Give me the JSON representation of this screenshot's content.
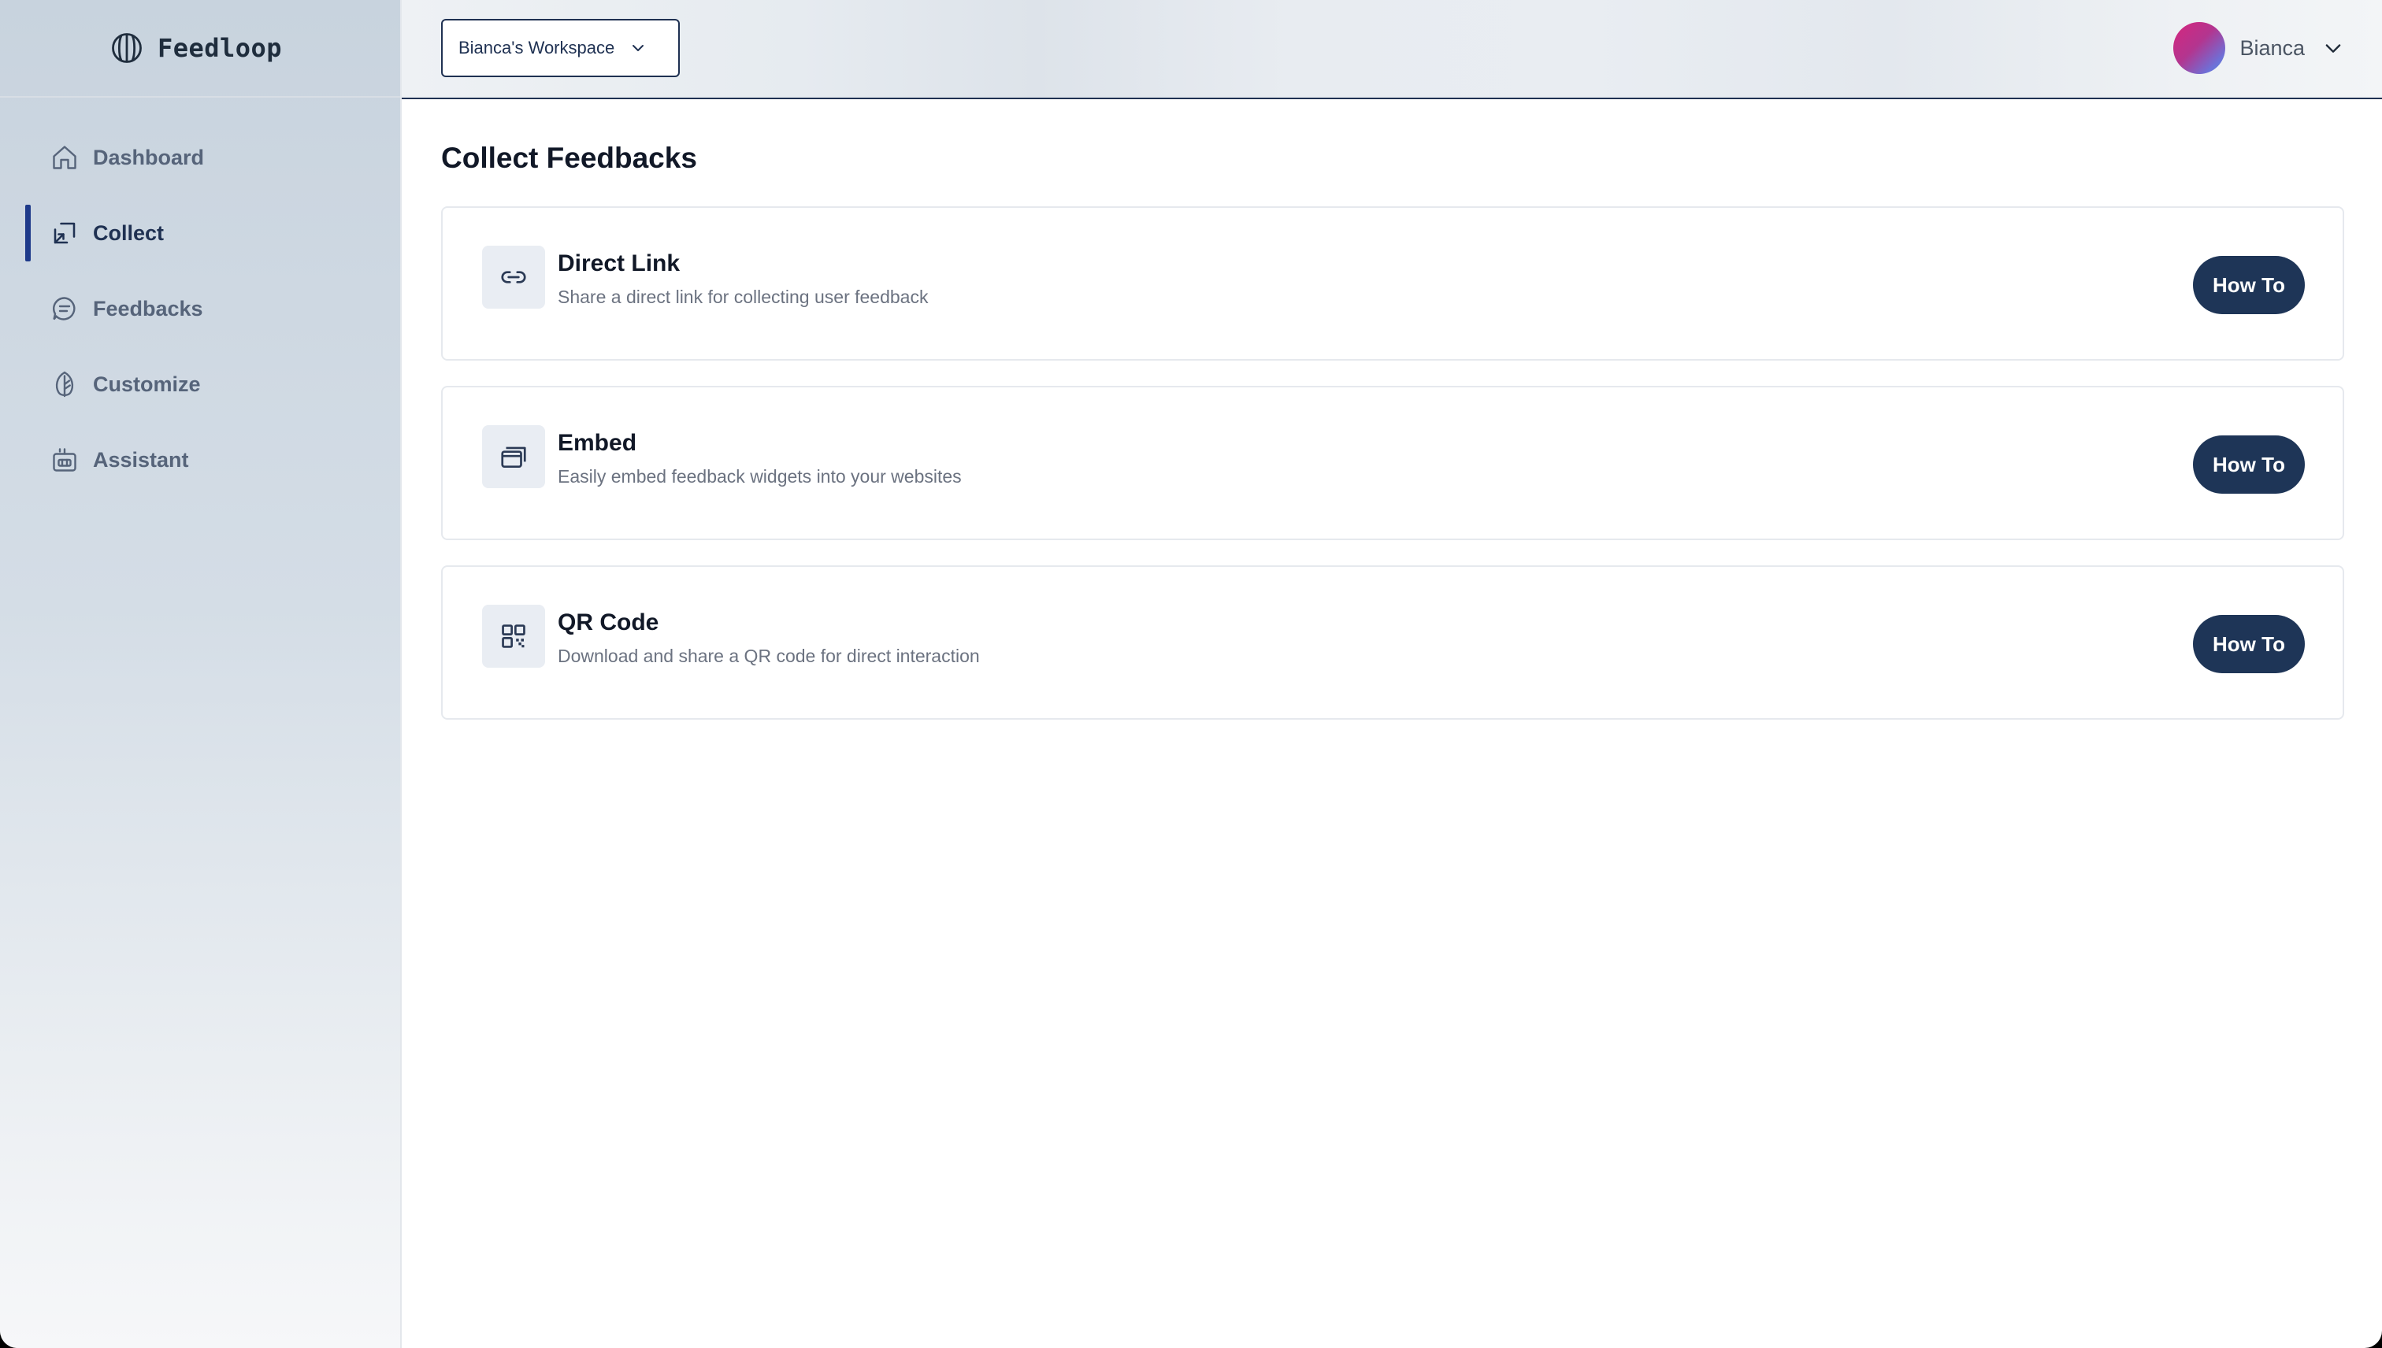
{
  "brand": {
    "name": "Feedloop",
    "icon": "logo-circle-icon"
  },
  "sidebar": {
    "items": [
      {
        "label": "Dashboard",
        "icon": "home-icon",
        "active": false
      },
      {
        "label": "Collect",
        "icon": "collect-cursor-icon",
        "active": true
      },
      {
        "label": "Feedbacks",
        "icon": "message-icon",
        "active": false
      },
      {
        "label": "Customize",
        "icon": "leaf-icon",
        "active": false
      },
      {
        "label": "Assistant",
        "icon": "bot-icon",
        "active": false
      }
    ]
  },
  "header": {
    "workspace_label": "Bianca's Workspace",
    "user_name": "Bianca"
  },
  "main": {
    "title": "Collect Feedbacks",
    "cards": [
      {
        "title": "Direct Link",
        "description": "Share a direct link for collecting user feedback",
        "icon": "link-icon",
        "button_label": "How To"
      },
      {
        "title": "Embed",
        "description": "Easily embed feedback widgets into your websites",
        "icon": "embed-window-icon",
        "button_label": "How To"
      },
      {
        "title": "QR Code",
        "description": "Download and share a QR code for direct interaction",
        "icon": "qr-code-icon",
        "button_label": "How To"
      }
    ]
  },
  "colors": {
    "accent": "#1e3a8a",
    "button": "#1e3557",
    "text_primary": "#111827",
    "text_muted": "#6b7280"
  }
}
